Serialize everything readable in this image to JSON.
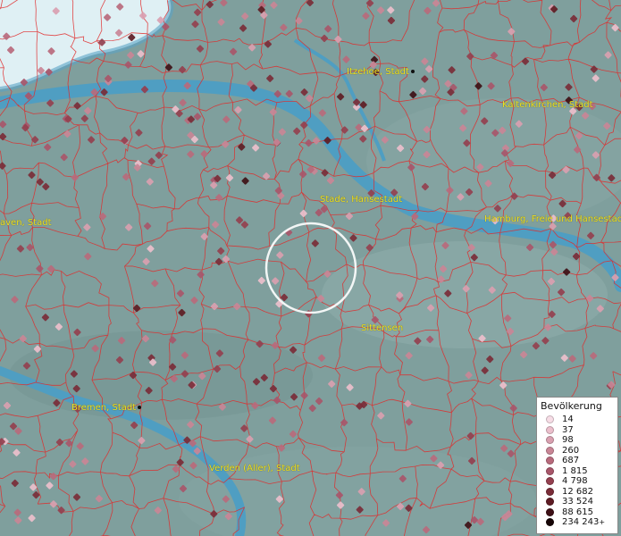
{
  "map": {
    "colors": {
      "land": "#7f9f9d",
      "water": "#4f9ec2",
      "sea": "#dff0f4",
      "boundaries": "#e02a2a",
      "label": "#f0e020"
    },
    "cities": [
      {
        "name": "Itzehoe, Stadt"
      },
      {
        "name": "Kaltenkirchen, Stadt"
      },
      {
        "name": "Stade, Hansestadt"
      },
      {
        "name": "Hamburg, Freie und Hansestadt"
      },
      {
        "name": "aven, Stadt"
      },
      {
        "name": "Sittensen"
      },
      {
        "name": "Bremen, Stadt"
      },
      {
        "name": "Verden (Aller), Stadt"
      }
    ]
  },
  "legend": {
    "title": "Bevölkerung",
    "items": [
      {
        "label": "14",
        "color": "#f7dde6"
      },
      {
        "label": "37",
        "color": "#ebbfcc"
      },
      {
        "label": "98",
        "color": "#d9a0b0"
      },
      {
        "label": "260",
        "color": "#c98696"
      },
      {
        "label": "687",
        "color": "#b86a7c"
      },
      {
        "label": "1 815",
        "color": "#a8566a"
      },
      {
        "label": "4 798",
        "color": "#94404f"
      },
      {
        "label": "12 682",
        "color": "#7a2c38"
      },
      {
        "label": "33 524",
        "color": "#5e1c24"
      },
      {
        "label": "88 615",
        "color": "#3e1016"
      },
      {
        "label": "234 243",
        "color": "#160406",
        "suffix": "+"
      }
    ]
  }
}
